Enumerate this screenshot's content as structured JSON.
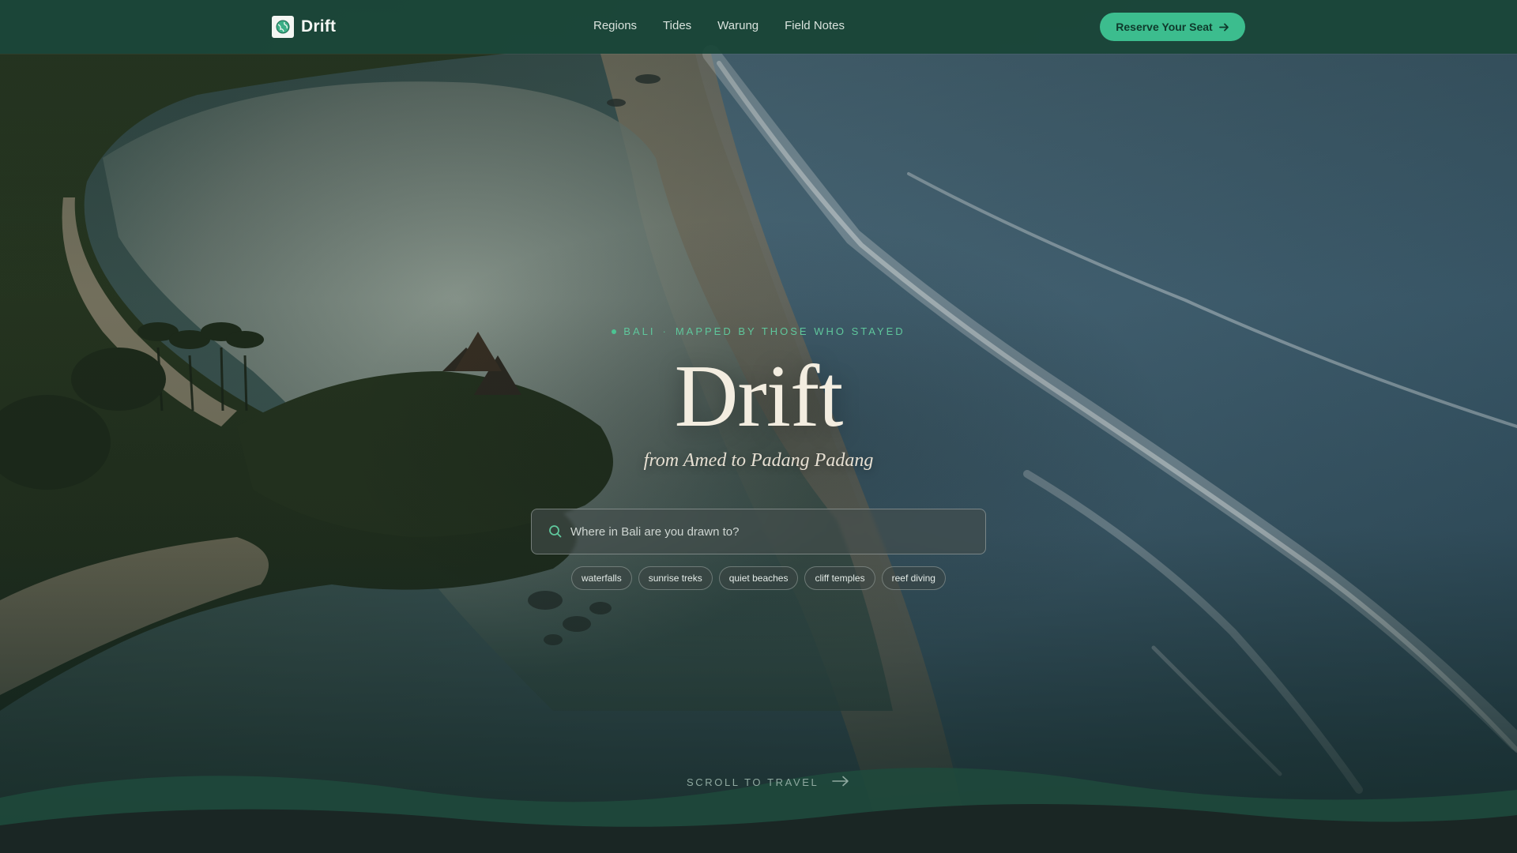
{
  "header": {
    "brand_name": "Drift",
    "logo_icon": "globe-icon",
    "nav": [
      {
        "label": "Regions"
      },
      {
        "label": "Tides"
      },
      {
        "label": "Warung"
      },
      {
        "label": "Field Notes"
      }
    ],
    "cta_label": "Reserve Your Seat",
    "cta_icon": "arrow-right-icon"
  },
  "hero": {
    "eyebrow_place": "BALI",
    "eyebrow_tagline": "MAPPED BY THOSE WHO STAYED",
    "title": "Drift",
    "subtitle": "from Amed to Padang Padang",
    "background": "aerial photo of Bali coastline with temple, palms and surf"
  },
  "search": {
    "placeholder": "Where in Bali are you drawn to?",
    "value": "",
    "icon": "search-icon"
  },
  "chips": [
    {
      "label": "waterfalls"
    },
    {
      "label": "sunrise treks"
    },
    {
      "label": "quiet beaches"
    },
    {
      "label": "cliff temples"
    },
    {
      "label": "reef diving"
    }
  ],
  "scroll_cue": {
    "label": "SCROLL TO TRAVEL",
    "icon": "arrow-right-icon"
  },
  "colors": {
    "header_bg": "#1a4638",
    "accent": "#3cbd8e",
    "eyebrow": "#5fc79c",
    "title": "#f3ede0",
    "footer_bg": "#1a2624"
  }
}
